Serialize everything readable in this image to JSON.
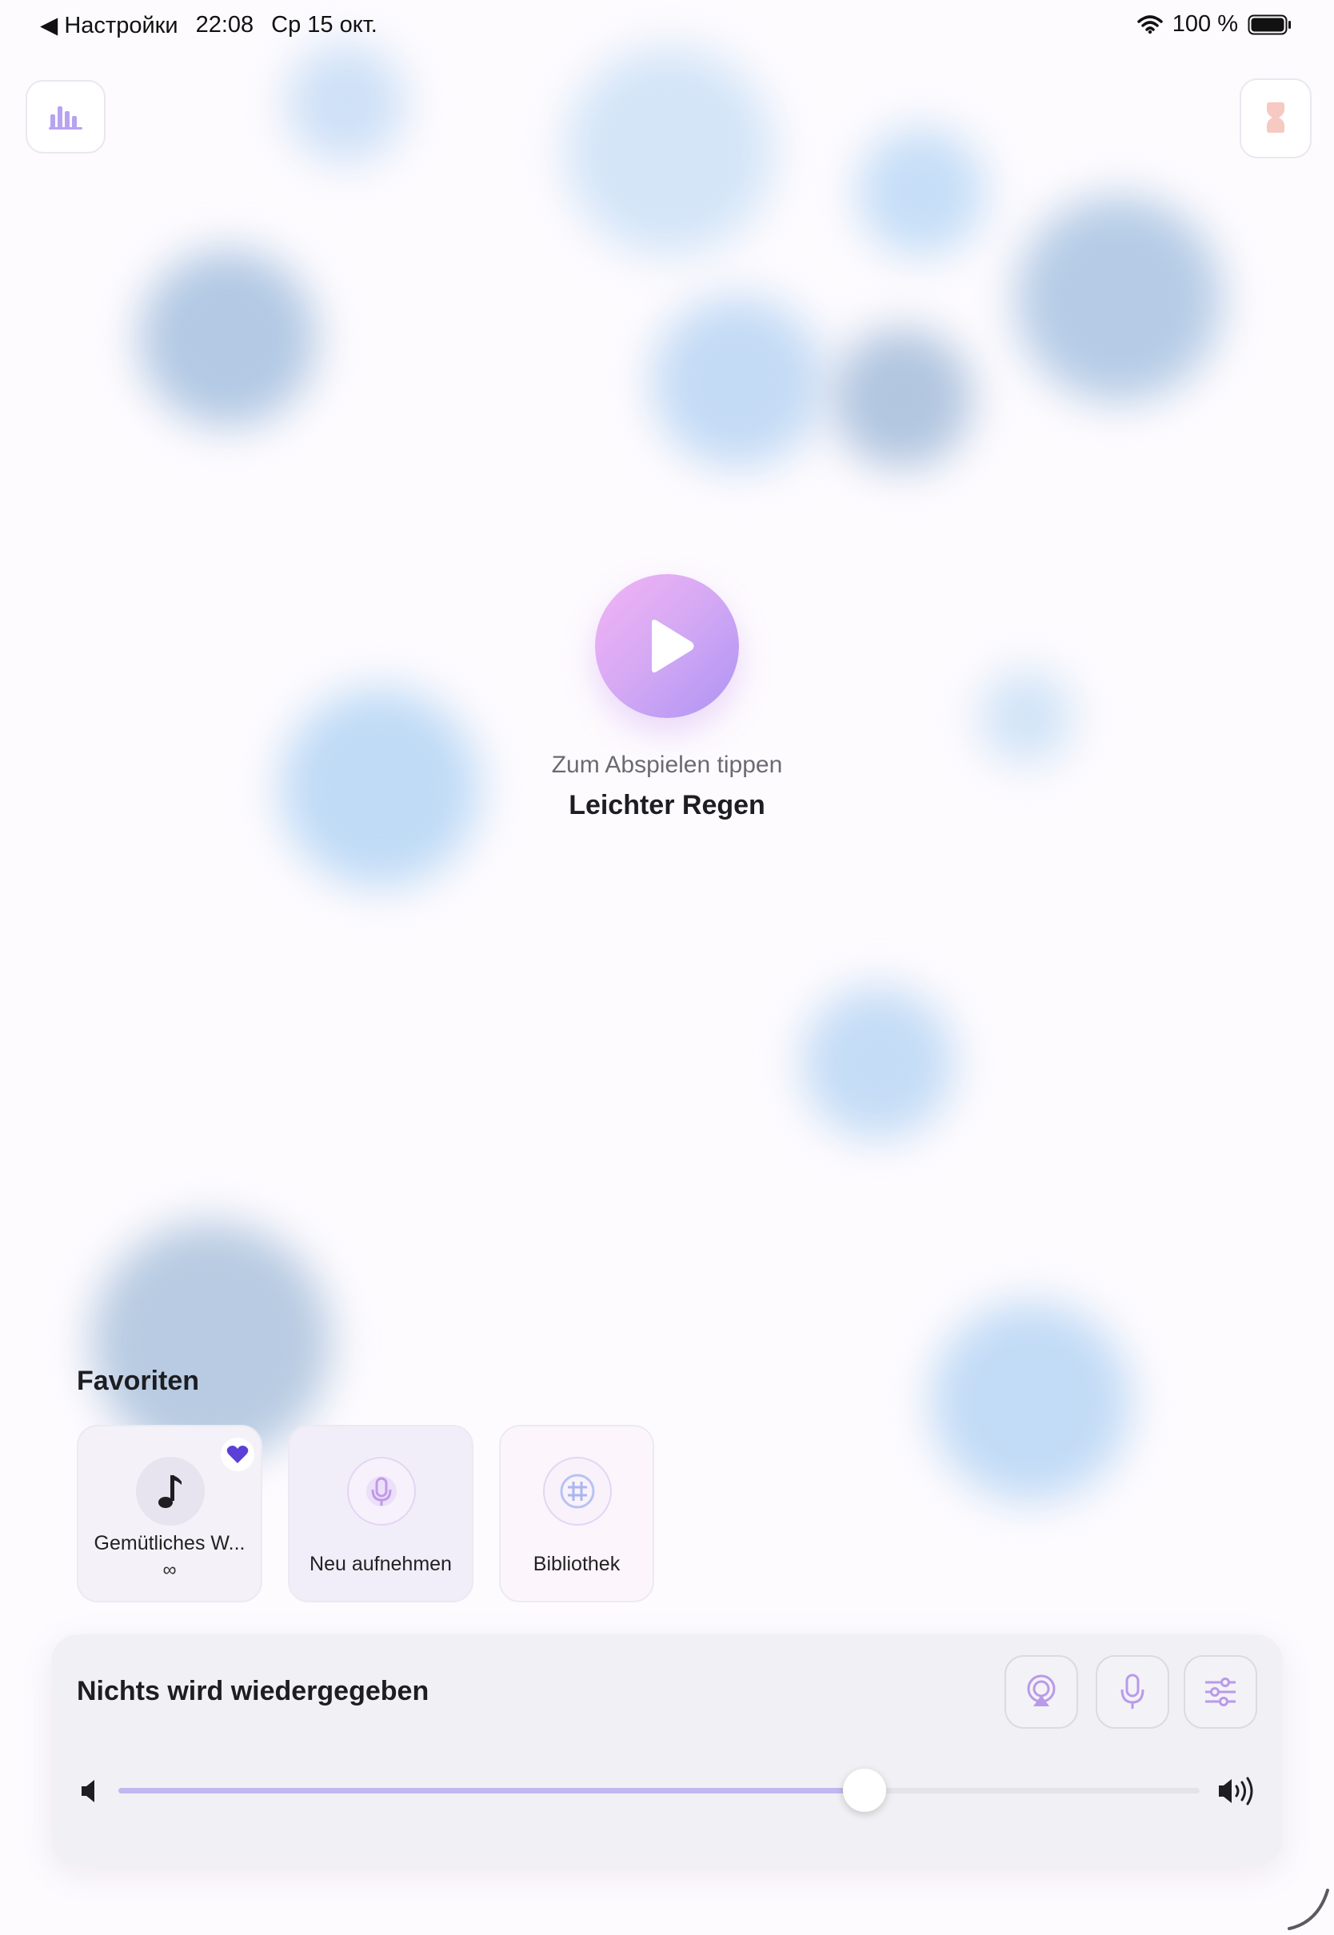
{
  "status_bar": {
    "back_label": "◀ Настройки",
    "time": "22:08",
    "date": "Ср 15 окт.",
    "battery": "100 %"
  },
  "icons": {
    "top_left": "bar-chart-icon",
    "top_right": "timer-icon"
  },
  "main": {
    "hint": "Zum Abspielen tippen",
    "sound_name": "Leichter Regen"
  },
  "favorites": {
    "title": "Favoriten",
    "items": [
      {
        "label": "Gemütliches W...",
        "sublabel": "∞",
        "icon": "music-note-icon",
        "favorite": true
      },
      {
        "label": "Neu aufnehmen",
        "icon": "microphone-icon"
      },
      {
        "label": "Bibliothek",
        "icon": "grid-icon"
      }
    ]
  },
  "player": {
    "status": "Nichts wird wiedergegeben",
    "volume": 0.69
  },
  "colors": {
    "accent": "#b79af3",
    "play_gradient_start": "#f4b4f4",
    "play_gradient_end": "#ad94f3",
    "heart": "#5b3fd6"
  }
}
